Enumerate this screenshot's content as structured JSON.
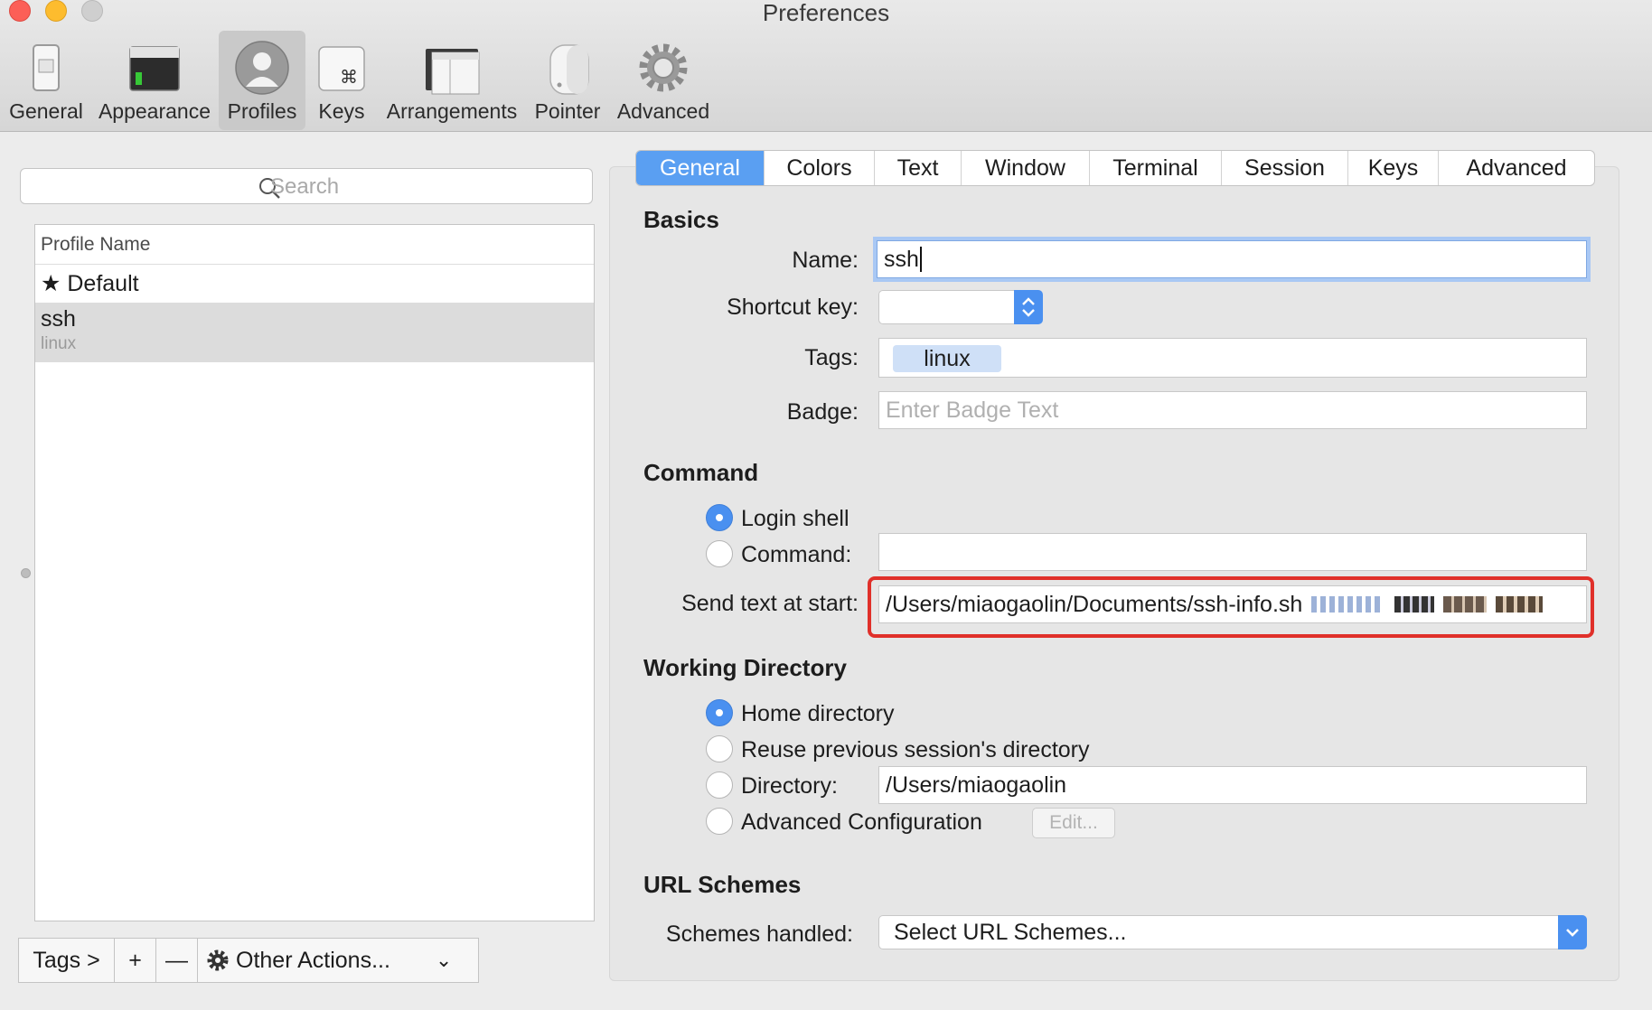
{
  "window": {
    "title": "Preferences"
  },
  "toolbar": {
    "items": [
      {
        "label": "General",
        "icon": "switch-icon"
      },
      {
        "label": "Appearance",
        "icon": "terminal-window-icon"
      },
      {
        "label": "Profiles",
        "icon": "user-silhouette-icon",
        "selected": true
      },
      {
        "label": "Keys",
        "icon": "command-key-icon"
      },
      {
        "label": "Arrangements",
        "icon": "windows-arrangement-icon"
      },
      {
        "label": "Pointer",
        "icon": "mouse-icon"
      },
      {
        "label": "Advanced",
        "icon": "gear-icon"
      }
    ]
  },
  "profiles": {
    "search_placeholder": "Search",
    "column_header": "Profile Name",
    "rows": [
      {
        "name": "★ Default"
      },
      {
        "name": "ssh",
        "tag": "linux",
        "selected": true
      }
    ],
    "bottom": {
      "tags": "Tags >",
      "add": "+",
      "remove": "—",
      "other": "Other Actions...",
      "chevron": "⌄"
    }
  },
  "tabs": {
    "items": [
      "General",
      "Colors",
      "Text",
      "Window",
      "Terminal",
      "Session",
      "Keys",
      "Advanced"
    ],
    "active": "General"
  },
  "basics": {
    "title": "Basics",
    "name_label": "Name:",
    "name_value": "ssh",
    "shortcut_label": "Shortcut key:",
    "tags_label": "Tags:",
    "tags_chip": "linux",
    "badge_label": "Badge:",
    "badge_placeholder": "Enter Badge Text"
  },
  "command": {
    "title": "Command",
    "login_shell": "Login shell",
    "command": "Command:",
    "send_text_label": "Send text at start:",
    "send_text_value": "/Users/miaogaolin/Documents/ssh-info.sh"
  },
  "working_dir": {
    "title": "Working Directory",
    "home": "Home directory",
    "reuse": "Reuse previous session's directory",
    "directory": "Directory:",
    "directory_value": "/Users/miaogaolin",
    "advanced": "Advanced Configuration",
    "edit": "Edit..."
  },
  "url": {
    "title": "URL Schemes",
    "schemes_label": "Schemes handled:",
    "schemes_value": "Select URL Schemes..."
  },
  "colors": {
    "accent": "#4a90f0",
    "tab_active": "#5a9ff2",
    "highlight": "#e0302a"
  }
}
